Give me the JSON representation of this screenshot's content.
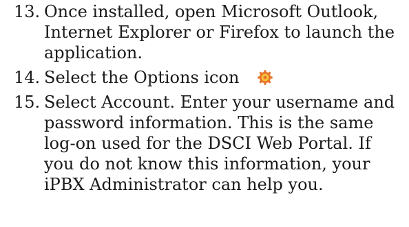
{
  "steps": [
    {
      "number": "13.",
      "text": "Once installed, open Microsoft Outlook, Internet Explorer or Firefox to launch the application."
    },
    {
      "number": "14.",
      "text": "Select the Options icon",
      "icon": "options-gear-icon"
    },
    {
      "number": "15.",
      "text": "Select Account.  Enter your username and password information.  This is the same log-on used for the DSCI Web Portal.  If you do not know this information, your iPBX Administrator can help you."
    }
  ],
  "colors": {
    "text": "#1a1a1a",
    "icon_orange": "#e8732a",
    "icon_yellow": "#f3c23a"
  }
}
